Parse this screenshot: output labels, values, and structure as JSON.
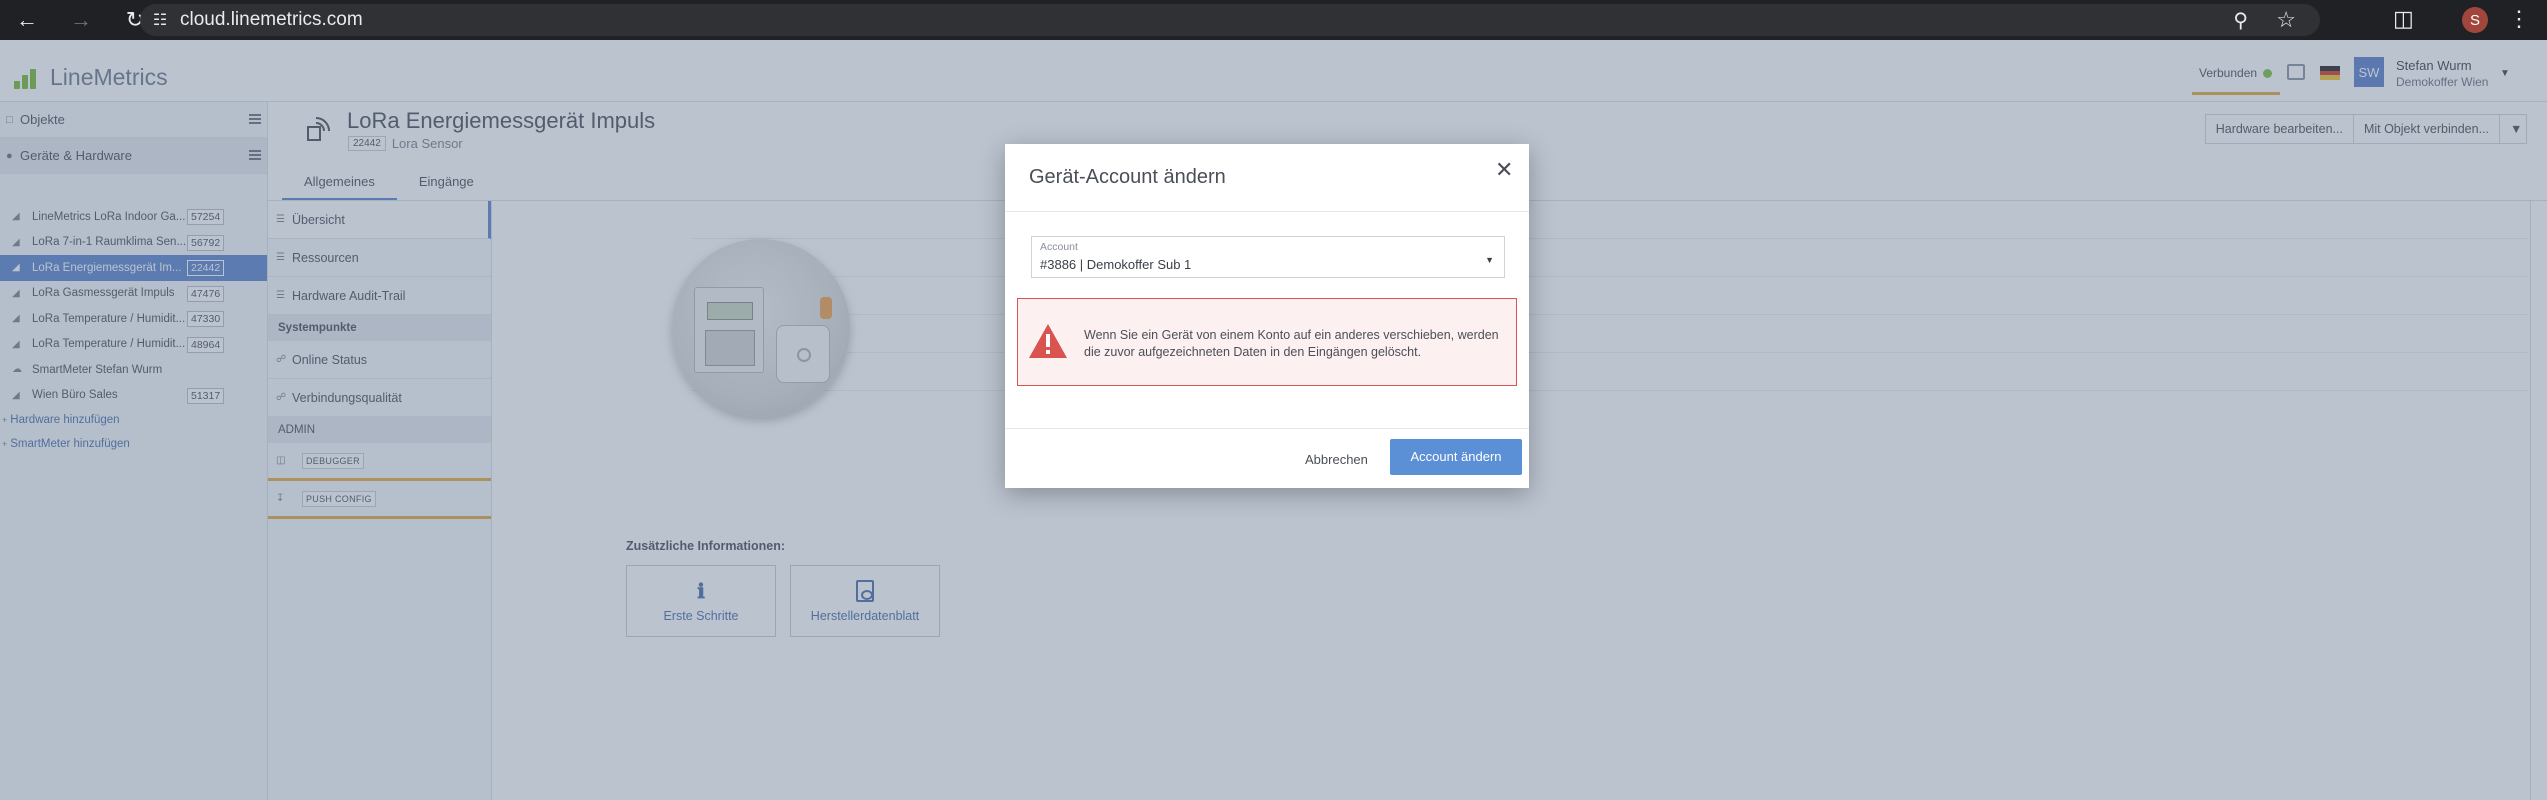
{
  "browser": {
    "url": "cloud.linemetrics.com",
    "profile_initial": "S"
  },
  "header": {
    "logo_text": "LineMetrics",
    "status_label": "Verbunden",
    "avatar_initials": "SW",
    "user_name": "Stefan Wurm",
    "user_org": "Demokoffer Wien",
    "colors": {
      "status_ok": "#7ac142",
      "accent": "#5b83cc",
      "highlight": "#e3a93b"
    }
  },
  "sidebar": {
    "categories": [
      {
        "label": "Objekte"
      },
      {
        "label": "Geräte & Hardware"
      }
    ],
    "devices": [
      {
        "name": "LineMetrics LoRa Indoor Ga...",
        "id": "57254"
      },
      {
        "name": "LoRa 7-in-1 Raumklima Sen...",
        "id": "56792"
      },
      {
        "name": "LoRa Energiemessgerät Im...",
        "id": "22442"
      },
      {
        "name": "LoRa Gasmessgerät Impuls",
        "id": "47476"
      },
      {
        "name": "LoRa Temperature / Humidit...",
        "id": "47330"
      },
      {
        "name": "LoRa Temperature / Humidit...",
        "id": "48964"
      },
      {
        "name": "SmartMeter Stefan Wurm",
        "id": ""
      },
      {
        "name": "Wien Büro Sales",
        "id": "51317"
      }
    ],
    "links": [
      {
        "label": "Hardware hinzufügen"
      },
      {
        "label": "SmartMeter hinzufügen"
      }
    ]
  },
  "page": {
    "title": "LoRa Energiemessgerät Impuls",
    "id_badge": "22442",
    "subtitle": "Lora Sensor",
    "tabs": [
      {
        "label": "Allgemeines"
      },
      {
        "label": "Eingänge"
      }
    ],
    "actions": {
      "edit": "Hardware bearbeiten...",
      "connect": "Mit Objekt verbinden..."
    }
  },
  "submenu": {
    "items": [
      {
        "label": "Übersicht"
      },
      {
        "label": "Ressourcen"
      },
      {
        "label": "Hardware Audit-Trail"
      }
    ],
    "section_systempunkte": "Systempunkte",
    "system_items": [
      {
        "label": "Online Status"
      },
      {
        "label": "Verbindungsqualität"
      }
    ],
    "section_admin": "ADMIN",
    "admin_items": [
      {
        "label": "DEBUGGER"
      },
      {
        "label": "PUSH CONFIG"
      }
    ]
  },
  "content": {
    "info_title": "Zusätzliche Informationen:",
    "cards": [
      {
        "label": "Erste Schritte"
      },
      {
        "label": "Herstellerdatenblatt"
      }
    ]
  },
  "modal": {
    "title": "Gerät-Account ändern",
    "field_label": "Account",
    "field_value": "#3886 | Demokoffer Sub 1",
    "warning": "Wenn Sie ein Gerät von einem Konto auf ein anderes verschieben, werden die zuvor aufgezeichneten Daten in den Eingängen gelöscht.",
    "cancel_label": "Abbrechen",
    "confirm_label": "Account ändern"
  }
}
